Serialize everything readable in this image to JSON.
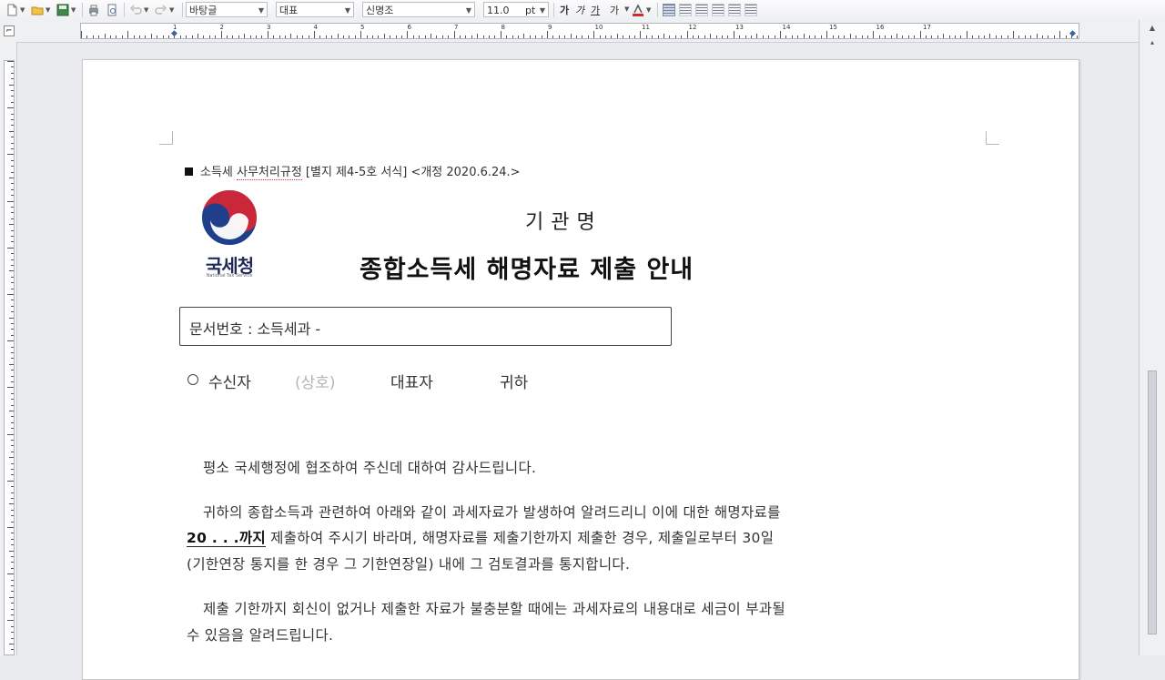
{
  "toolbar": {
    "style_value": "바탕글",
    "font_lang_value": "대표",
    "font_value": "신명조",
    "font_size_value": "11.0",
    "font_size_unit": "pt",
    "format_labels": [
      "가",
      "가",
      "가",
      "가"
    ]
  },
  "ruler": {
    "h_numbers": [
      "1",
      "2",
      "3",
      "4",
      "5",
      "6",
      "7",
      "8",
      "9",
      "10",
      "11",
      "12",
      "13",
      "14",
      "15",
      "16",
      "17"
    ]
  },
  "document": {
    "header_prefix": "소득세 ",
    "header_underlined": "사무처리규정",
    "header_suffix": " [별지 제4-5호 서식] <개정 2020.6.24.>",
    "logo_text": "국세청",
    "logo_subtext": "National Tax Service",
    "org_name": "기관명",
    "title": "종합소득세 해명자료 제출 안내",
    "doc_number_label": "문서번호 : 소득세과 -",
    "recipient": {
      "label": "수신자",
      "company": "(상호)",
      "rep": "대표자",
      "honorific": "귀하"
    },
    "para1": "평소 국세행정에 협조하여 주신데 대하여 감사드립니다.",
    "para2_line1": "귀하의 종합소득과 관련하여 아래와 같이 과세자료가 발생하여 알려드리니 이에 대한 해명자료를",
    "para2_deadline": "20   .   .   .까지",
    "para2_line2_rest": " 제출하여 주시기 바라며, 해명자료를 제출기한까지 제출한 경우, 제출일로부터 30일",
    "para2_line3": "(기한연장 통지를 한 경우 그 기한연장일) 내에 그 검토결과를 통지합니다.",
    "para3_line1": "제출 기한까지 회신이 없거나 제출한 자료가 불충분할 때에는 과세자료의 내용대로 세금이 부과될",
    "para3_line2": "수 있음을 알려드립니다."
  },
  "colors": {
    "logo_blue": "#1f3f8a",
    "logo_red": "#c8283a",
    "accent": "#3a62a8"
  }
}
